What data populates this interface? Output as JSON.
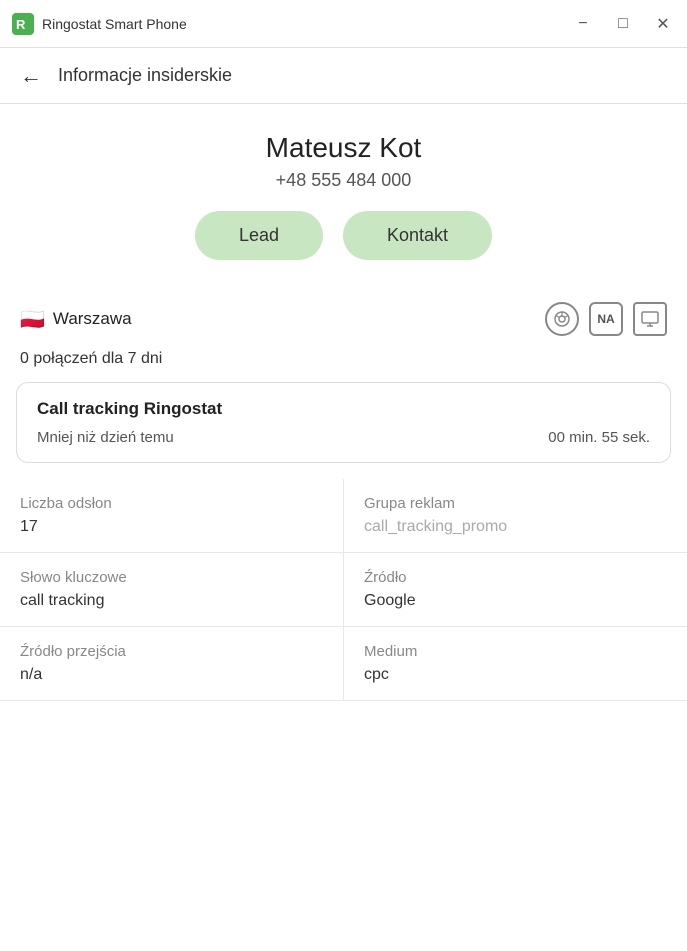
{
  "titleBar": {
    "appName": "Ringostat Smart Phone",
    "minimizeLabel": "−",
    "maximizeLabel": "□",
    "closeLabel": "✕"
  },
  "subHeader": {
    "backLabel": "←",
    "title": "Informacje insiderskie"
  },
  "contact": {
    "name": "Mateusz Kot",
    "phone": "+48 555 484 000",
    "leadButton": "Lead",
    "contactButton": "Kontakt"
  },
  "location": {
    "flag": "🇵🇱",
    "city": "Warszawa"
  },
  "icons": {
    "chrome": "⊙",
    "badge": "NA",
    "monitor": "⬜"
  },
  "connections": {
    "text": "0 połączeń dla 7 dni"
  },
  "callTracking": {
    "title": "Call tracking Ringostat",
    "timeLabel": "Mniej niż dzień temu",
    "duration": "00 min.  55 sek."
  },
  "stats": {
    "rows": [
      {
        "col1Label": "Liczba odsłon",
        "col1Value": "17",
        "col1Muted": false,
        "col2Label": "Grupa reklam",
        "col2Value": "call_tracking_promo",
        "col2Muted": true
      },
      {
        "col1Label": "Słowo kluczowe",
        "col1Value": "call tracking",
        "col1Muted": false,
        "col2Label": "Źródło",
        "col2Value": "Google",
        "col2Muted": false
      },
      {
        "col1Label": "Źródło przejścia",
        "col1Value": "n/a",
        "col1Muted": false,
        "col2Label": "Medium",
        "col2Value": "cpc",
        "col2Muted": false
      }
    ]
  }
}
